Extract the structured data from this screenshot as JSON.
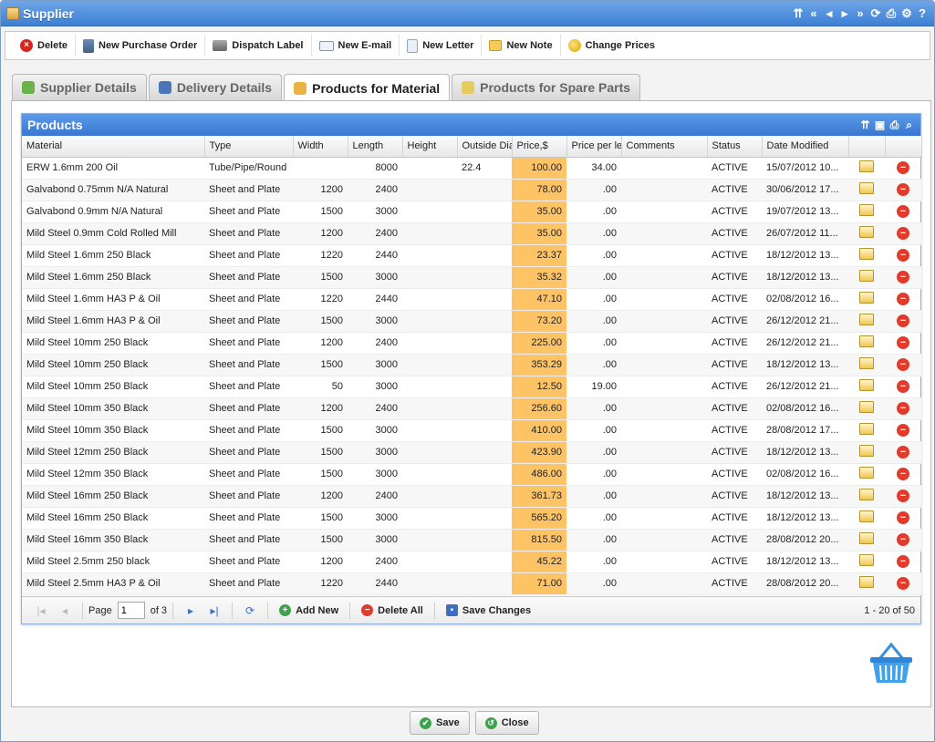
{
  "window": {
    "title": "Supplier",
    "tools": [
      "⇈",
      "«",
      "◂",
      "▸",
      "»",
      "⟳",
      "⎙",
      "⚙",
      "?"
    ]
  },
  "toolbar": [
    {
      "label": "Delete",
      "icon": "delete-icon"
    },
    {
      "label": "New Purchase Order",
      "icon": "purchase-order-icon"
    },
    {
      "label": "Dispatch Label",
      "icon": "printer-icon"
    },
    {
      "label": "New E-mail",
      "icon": "email-icon"
    },
    {
      "label": "New Letter",
      "icon": "letter-icon"
    },
    {
      "label": "New Note",
      "icon": "note-icon"
    },
    {
      "label": "Change Prices",
      "icon": "coins-icon"
    }
  ],
  "tabs": [
    {
      "label": "Supplier Details",
      "active": false
    },
    {
      "label": "Delivery Details",
      "active": false
    },
    {
      "label": "Products for Material",
      "active": true
    },
    {
      "label": "Products for Spare Parts",
      "active": false
    }
  ],
  "panel": {
    "title": "Products"
  },
  "columns": [
    "Material",
    "Type",
    "Width",
    "Length",
    "Height",
    "Outside Dia",
    "Price,$",
    "Price per le",
    "Comments",
    "Status",
    "Date Modified",
    "",
    ""
  ],
  "rows": [
    [
      "ERW 1.6mm 200 Oil",
      "Tube/Pipe/Round",
      "",
      "8000",
      "",
      "22.4",
      "100.00",
      "34.00",
      "",
      "ACTIVE",
      "15/07/2012 10..."
    ],
    [
      "Galvabond 0.75mm N/A Natural",
      "Sheet and Plate",
      "1200",
      "2400",
      "",
      "",
      "78.00",
      ".00",
      "",
      "ACTIVE",
      "30/06/2012 17..."
    ],
    [
      "Galvabond 0.9mm N/A Natural",
      "Sheet and Plate",
      "1500",
      "3000",
      "",
      "",
      "35.00",
      ".00",
      "",
      "ACTIVE",
      "19/07/2012 13..."
    ],
    [
      "Mild Steel 0.9mm Cold Rolled Mill",
      "Sheet and Plate",
      "1200",
      "2400",
      "",
      "",
      "35.00",
      ".00",
      "",
      "ACTIVE",
      "26/07/2012 11..."
    ],
    [
      "Mild Steel 1.6mm 250 Black",
      "Sheet and Plate",
      "1220",
      "2440",
      "",
      "",
      "23.37",
      ".00",
      "",
      "ACTIVE",
      "18/12/2012 13..."
    ],
    [
      "Mild Steel 1.6mm 250 Black",
      "Sheet and Plate",
      "1500",
      "3000",
      "",
      "",
      "35.32",
      ".00",
      "",
      "ACTIVE",
      "18/12/2012 13..."
    ],
    [
      "Mild Steel 1.6mm HA3 P & Oil",
      "Sheet and Plate",
      "1220",
      "2440",
      "",
      "",
      "47.10",
      ".00",
      "",
      "ACTIVE",
      "02/08/2012 16..."
    ],
    [
      "Mild Steel 1.6mm HA3 P & Oil",
      "Sheet and Plate",
      "1500",
      "3000",
      "",
      "",
      "73.20",
      ".00",
      "",
      "ACTIVE",
      "26/12/2012 21..."
    ],
    [
      "Mild Steel 10mm 250 Black",
      "Sheet and Plate",
      "1200",
      "2400",
      "",
      "",
      "225.00",
      ".00",
      "",
      "ACTIVE",
      "26/12/2012 21..."
    ],
    [
      "Mild Steel 10mm 250 Black",
      "Sheet and Plate",
      "1500",
      "3000",
      "",
      "",
      "353.29",
      ".00",
      "",
      "ACTIVE",
      "18/12/2012 13..."
    ],
    [
      "Mild Steel 10mm 250 Black",
      "Sheet and Plate",
      "50",
      "3000",
      "",
      "",
      "12.50",
      "19.00",
      "",
      "ACTIVE",
      "26/12/2012 21..."
    ],
    [
      "Mild Steel 10mm 350 Black",
      "Sheet and Plate",
      "1200",
      "2400",
      "",
      "",
      "256.60",
      ".00",
      "",
      "ACTIVE",
      "02/08/2012 16..."
    ],
    [
      "Mild Steel 10mm 350 Black",
      "Sheet and Plate",
      "1500",
      "3000",
      "",
      "",
      "410.00",
      ".00",
      "",
      "ACTIVE",
      "28/08/2012 17..."
    ],
    [
      "Mild Steel 12mm 250 Black",
      "Sheet and Plate",
      "1500",
      "3000",
      "",
      "",
      "423.90",
      ".00",
      "",
      "ACTIVE",
      "18/12/2012 13..."
    ],
    [
      "Mild Steel 12mm 350 Black",
      "Sheet and Plate",
      "1500",
      "3000",
      "",
      "",
      "486.00",
      ".00",
      "",
      "ACTIVE",
      "02/08/2012 16..."
    ],
    [
      "Mild Steel 16mm 250 Black",
      "Sheet and Plate",
      "1200",
      "2400",
      "",
      "",
      "361.73",
      ".00",
      "",
      "ACTIVE",
      "18/12/2012 13..."
    ],
    [
      "Mild Steel 16mm 250 Black",
      "Sheet and Plate",
      "1500",
      "3000",
      "",
      "",
      "565.20",
      ".00",
      "",
      "ACTIVE",
      "18/12/2012 13..."
    ],
    [
      "Mild Steel 16mm 350 Black",
      "Sheet and Plate",
      "1500",
      "3000",
      "",
      "",
      "815.50",
      ".00",
      "",
      "ACTIVE",
      "28/08/2012 20..."
    ],
    [
      "Mild Steel 2.5mm 250 black",
      "Sheet and Plate",
      "1200",
      "2400",
      "",
      "",
      "45.22",
      ".00",
      "",
      "ACTIVE",
      "18/12/2012 13..."
    ],
    [
      "Mild Steel 2.5mm HA3 P & Oil",
      "Sheet and Plate",
      "1220",
      "2440",
      "",
      "",
      "71.00",
      ".00",
      "",
      "ACTIVE",
      "28/08/2012 20..."
    ]
  ],
  "pager": {
    "page_label": "Page",
    "page_value": "1",
    "of_label": "of 3",
    "add_label": "Add New",
    "delete_all_label": "Delete All",
    "save_label": "Save Changes",
    "summary": "1 - 20 of 50"
  },
  "footer": {
    "save_label": "Save",
    "close_label": "Close"
  },
  "colors": {
    "accent": "#3d7fd3",
    "price_highlight": "#fdc365",
    "delete": "#e23a2b"
  }
}
